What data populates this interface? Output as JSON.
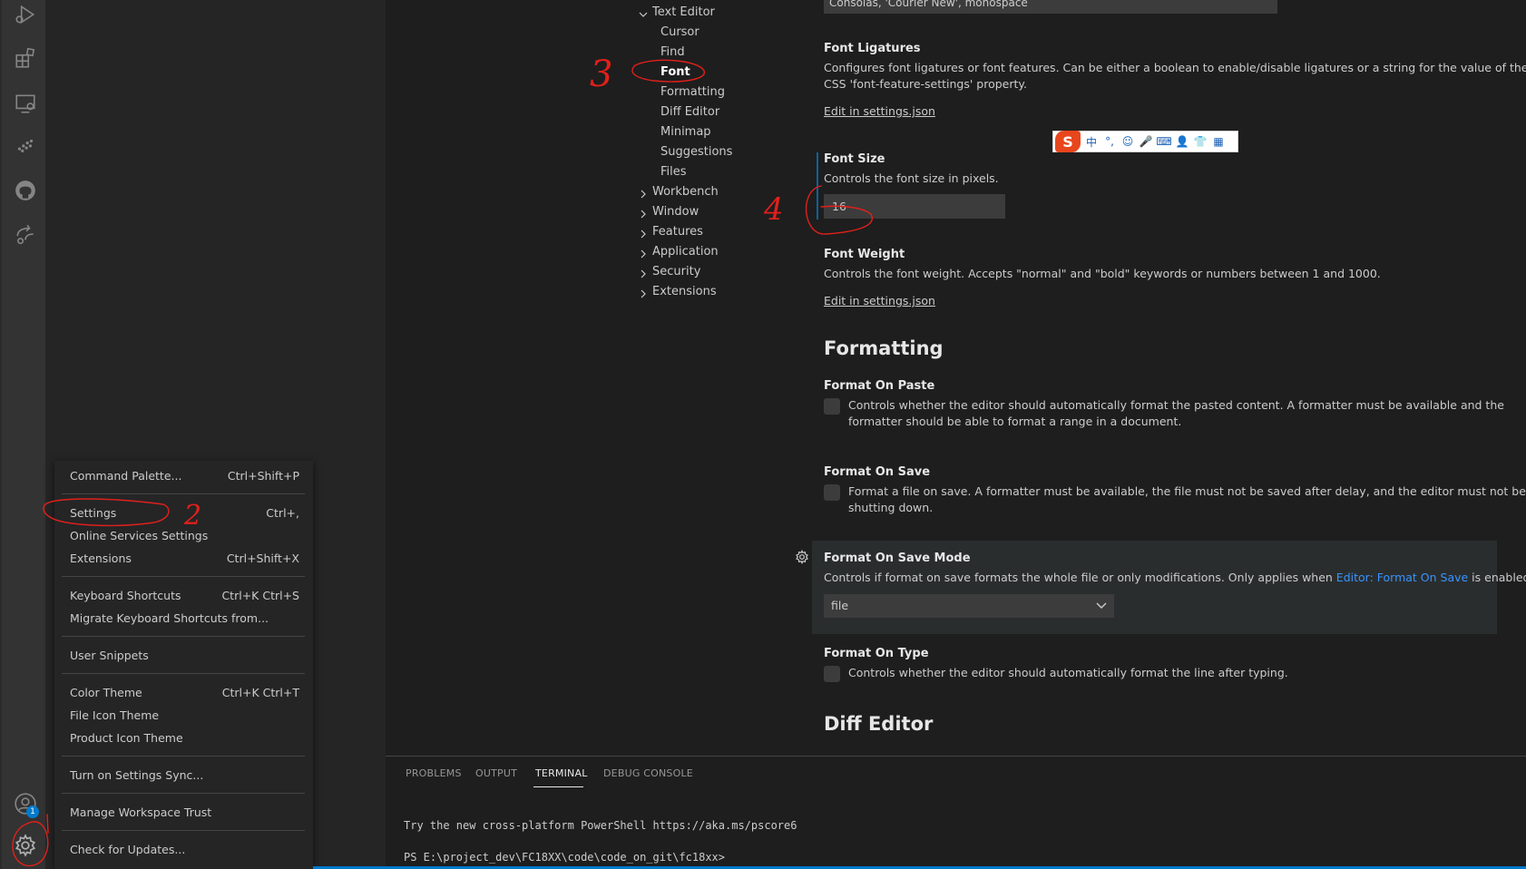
{
  "colors": {
    "activity_bar": "#333333",
    "sidebar": "#252526",
    "editor_bg": "#1e1e1e",
    "accent_link": "#3794ff",
    "focus_bar": "#0e639c",
    "annotation_red": "#e0201b",
    "status_blue": "#007acc"
  },
  "activity_bar": {
    "icons": [
      "run-debug-icon",
      "extensions-icon",
      "remote-explorer-icon",
      "testing-icon",
      "github-icon",
      "live-share-icon",
      "accounts-icon",
      "manage-gear-icon"
    ],
    "accounts_badge": "1"
  },
  "toc": {
    "text_editor": "Text Editor",
    "children": [
      "Cursor",
      "Find",
      "Font",
      "Formatting",
      "Diff Editor",
      "Minimap",
      "Suggestions",
      "Files"
    ],
    "active_child": "Font",
    "collapsed": [
      "Workbench",
      "Window",
      "Features",
      "Application",
      "Security",
      "Extensions"
    ]
  },
  "settings": {
    "font_family_value": "Consolas, 'Courier New', monospace",
    "font_ligatures": {
      "title": "Font Ligatures",
      "desc_line1": "Configures font ligatures or font features. Can be either a boolean to enable/disable ligatures or a string for the value of the",
      "desc_line2": "CSS 'font-feature-settings' property.",
      "link": "Edit in settings.json"
    },
    "font_size": {
      "title": "Font Size",
      "desc": "Controls the font size in pixels.",
      "value": "16"
    },
    "font_weight": {
      "title": "Font Weight",
      "desc": "Controls the font weight. Accepts \"normal\" and \"bold\" keywords or numbers between 1 and 1000.",
      "link": "Edit in settings.json"
    },
    "formatting_header": "Formatting",
    "format_on_paste": {
      "title": "Format On Paste",
      "desc_line1": "Controls whether the editor should automatically format the pasted content. A formatter must be available and the",
      "desc_line2": "formatter should be able to format a range in a document."
    },
    "format_on_save": {
      "title": "Format On Save",
      "desc_line1": "Format a file on save. A formatter must be available, the file must not be saved after delay, and the editor must not be",
      "desc_line2": "shutting down."
    },
    "format_on_save_mode": {
      "title": "Format On Save Mode",
      "desc_prefix": "Controls if format on save formats the whole file or only modifications. Only applies when ",
      "desc_link": "Editor: Format On Save",
      "desc_suffix": " is enabled.",
      "value": "file"
    },
    "format_on_type": {
      "title": "Format On Type",
      "desc": "Controls whether the editor should automatically format the line after typing."
    },
    "diff_editor_header": "Diff Editor"
  },
  "ime_toolbar": {
    "logo": "S",
    "items": [
      "中",
      "°,",
      "☺",
      "🎤",
      "⌨",
      "👤",
      "👕",
      "▦"
    ]
  },
  "panel": {
    "tabs": [
      "PROBLEMS",
      "OUTPUT",
      "TERMINAL",
      "DEBUG CONSOLE"
    ],
    "active_tab": "TERMINAL",
    "terminal_lines": [
      "Try the new cross-platform PowerShell https://aka.ms/pscore6",
      "PS E:\\project_dev\\FC18XX\\code\\code_on_git\\fc18xx>"
    ]
  },
  "context_menu": {
    "items": [
      {
        "label": "Command Palette...",
        "shortcut": "Ctrl+Shift+P"
      },
      {
        "label": "Settings",
        "shortcut": "Ctrl+,"
      },
      {
        "label": "Online Services Settings",
        "shortcut": ""
      },
      {
        "label": "Extensions",
        "shortcut": "Ctrl+Shift+X"
      },
      {
        "label": "Keyboard Shortcuts",
        "shortcut": "Ctrl+K Ctrl+S"
      },
      {
        "label": "Migrate Keyboard Shortcuts from...",
        "shortcut": ""
      },
      {
        "label": "User Snippets",
        "shortcut": ""
      },
      {
        "label": "Color Theme",
        "shortcut": "Ctrl+K Ctrl+T"
      },
      {
        "label": "File Icon Theme",
        "shortcut": ""
      },
      {
        "label": "Product Icon Theme",
        "shortcut": ""
      },
      {
        "label": "Turn on Settings Sync...",
        "shortcut": ""
      },
      {
        "label": "Manage Workspace Trust",
        "shortcut": ""
      },
      {
        "label": "Check for Updates...",
        "shortcut": ""
      }
    ]
  },
  "annotations": {
    "step_2": "2",
    "step_3": "3",
    "step_4": "4"
  }
}
